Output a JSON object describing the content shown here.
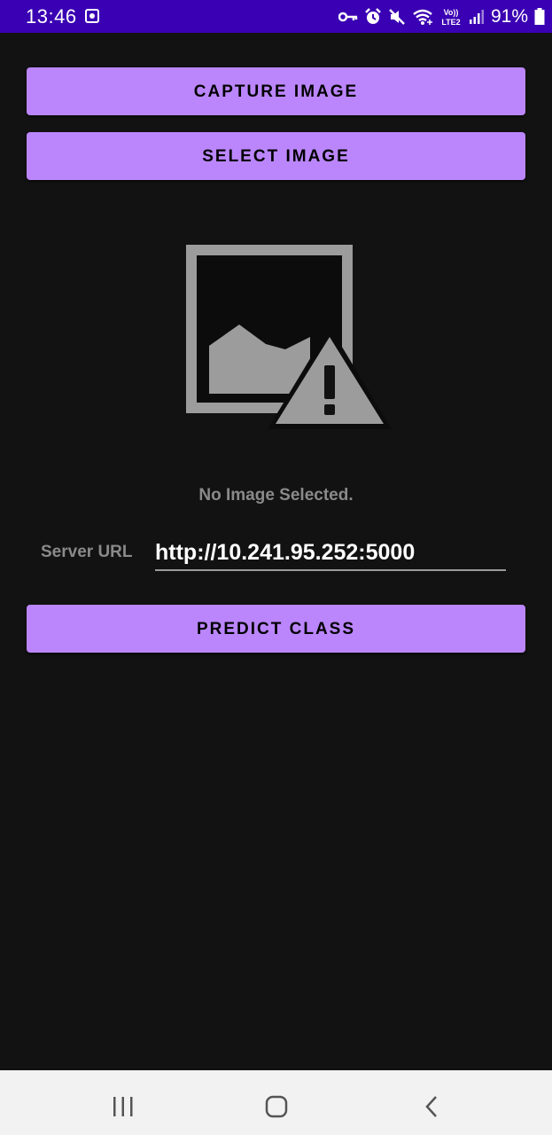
{
  "status_bar": {
    "time": "13:46",
    "battery_percent": "91%",
    "network": "LTE2",
    "icons": [
      "notification-icon",
      "vpn-key-icon",
      "alarm-icon",
      "mute-icon",
      "wifi-icon",
      "volte-icon",
      "signal-icon",
      "battery-icon"
    ]
  },
  "buttons": {
    "capture_label": "CAPTURE IMAGE",
    "select_label": "SELECT IMAGE",
    "predict_label": "PREDICT CLASS"
  },
  "preview": {
    "icon": "broken-image-icon",
    "status_text": "No Image Selected."
  },
  "server": {
    "label": "Server URL",
    "value": "http://10.241.95.252:5000"
  },
  "colors": {
    "status_bar": "#3a00b3",
    "background": "#121212",
    "button": "#bb86fc",
    "muted_text": "#8a8a8a",
    "nav_bar": "#f2f2f2"
  }
}
